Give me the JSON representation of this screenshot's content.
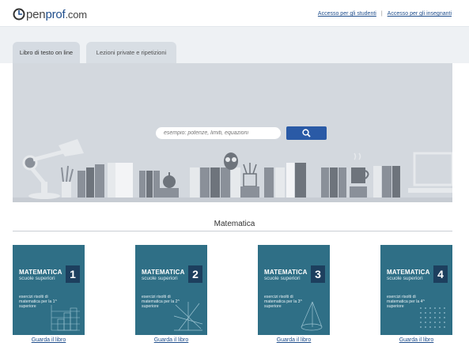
{
  "header": {
    "logo_o": "o",
    "logo_pen": "pen",
    "logo_prof": "prof",
    "logo_dotcom": ".com",
    "link_students": "Accesso per gli studenti",
    "separator": "|",
    "link_teachers": "Accesso per gli insegnanti"
  },
  "tabs": [
    {
      "label": "Libro di testo on line",
      "active": true
    },
    {
      "label": "Lezioni private e ripetizioni",
      "active": false
    }
  ],
  "search": {
    "placeholder": "esempio: potenze, limiti, equazioni",
    "button_icon": "search-icon"
  },
  "section": {
    "title": "Matematica"
  },
  "books": [
    {
      "title": "MATEMATICA",
      "subtitle": "scuole superiori",
      "number": "1",
      "description": "esercizi risolti di matematica per la 1^ superiore",
      "link": "Guarda il libro"
    },
    {
      "title": "MATEMATICA",
      "subtitle": "scuole superiori",
      "number": "2",
      "description": "esercizi risolti di matematica per la 2^ superiore",
      "link": "Guarda il libro"
    },
    {
      "title": "MATEMATICA",
      "subtitle": "scuole superiori",
      "number": "3",
      "description": "esercizi risolti di matematica per la 3^ superiore",
      "link": "Guarda il libro"
    },
    {
      "title": "MATEMATICA",
      "subtitle": "scuole superiori",
      "number": "4",
      "description": "esercizi risolti di matematica per la 4^ superiore",
      "link": "Guarda il libro"
    }
  ],
  "colors": {
    "brand_blue": "#1f4e8c",
    "book_cover": "#2f6f86",
    "hero_bg": "#d3d8de"
  }
}
